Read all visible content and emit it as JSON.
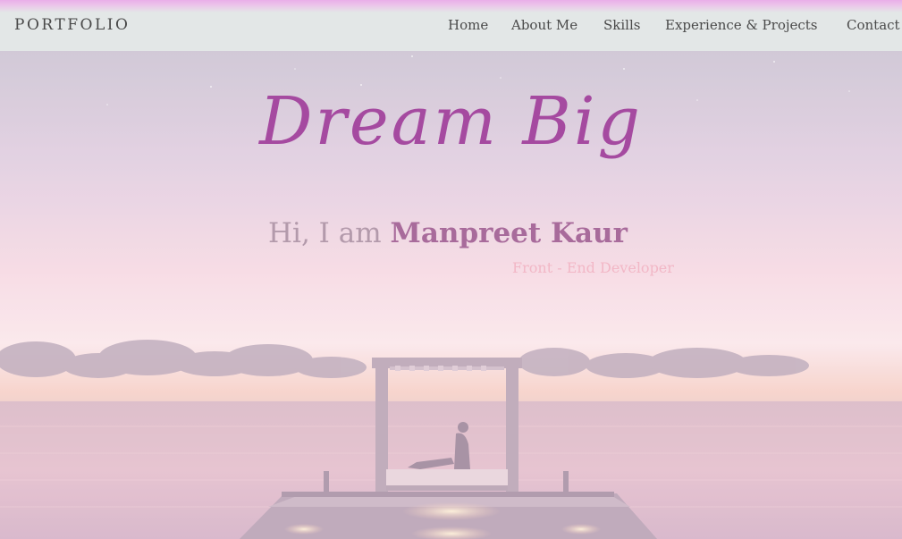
{
  "nav": {
    "brand": "PORTFOLIO",
    "links": [
      "Home",
      "About Me",
      "Skills",
      "Experience & Projects",
      "Contact"
    ]
  },
  "hero": {
    "headline": "Dream Big",
    "greeting_prefix": "Hi, I am ",
    "name": "Manpreet Kaur",
    "role": "Front - End Developer",
    "background": "sunset-pier-image"
  },
  "colors": {
    "headline": "#a54aa0",
    "name": "#a86b9b",
    "nav_top": "#e9aee9",
    "nav_bg": "#e3e7e7"
  }
}
